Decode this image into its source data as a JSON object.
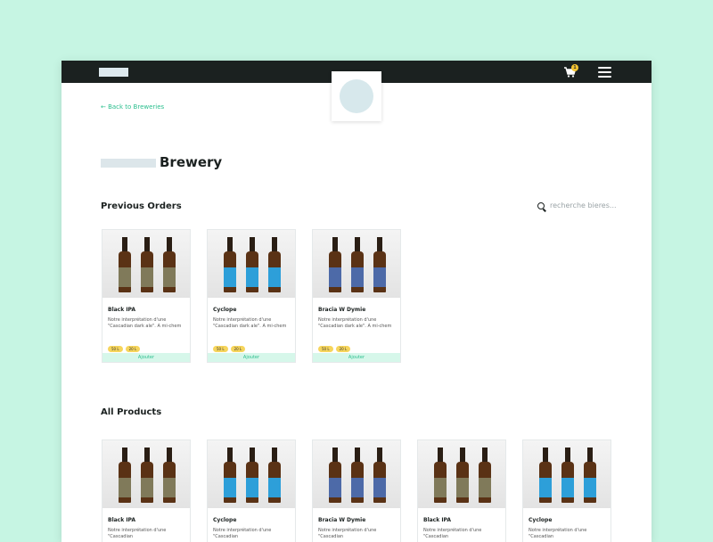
{
  "nav": {
    "cart_count": "1"
  },
  "back_link": "← Back to Breweries",
  "page_title": "Brewery",
  "previous_orders": {
    "title": "Previous Orders",
    "search_placeholder": "recherche bieres...",
    "items": [
      {
        "name": "Black IPA",
        "desc": "Notre interprétation d'une \"Cascadian dark ale\". A mi-chem",
        "tag1": "50 L",
        "tag2": "20 L",
        "add": "Ajouter",
        "label_color": "#807a5a"
      },
      {
        "name": "Cyclope",
        "desc": "Notre interprétation d'une \"Cascadian dark ale\". A mi-chem",
        "tag1": "50 L",
        "tag2": "20 L",
        "add": "Ajouter",
        "label_color": "#2d9fd9"
      },
      {
        "name": "Bracia W Dymie",
        "desc": "Notre interprétation d'une \"Cascadian dark ale\". A mi-chem",
        "tag1": "50 L",
        "tag2": "20 L",
        "add": "Ajouter",
        "label_color": "#4d6aa8"
      }
    ]
  },
  "all_products": {
    "title": "All Products",
    "items": [
      {
        "name": "Black IPA",
        "desc": "Notre interprétation d'une \"Cascadian",
        "label_color": "#807a5a"
      },
      {
        "name": "Cyclope",
        "desc": "Notre interprétation d'une \"Cascadian",
        "label_color": "#2d9fd9"
      },
      {
        "name": "Bracia W Dymie",
        "desc": "Notre interprétation d'une \"Cascadian",
        "label_color": "#4d6aa8"
      },
      {
        "name": "Black IPA",
        "desc": "Notre interprétation d'une \"Cascadian",
        "label_color": "#807a5a"
      },
      {
        "name": "Cyclope",
        "desc": "Notre interprétation d'une \"Cascadian",
        "label_color": "#2d9fd9"
      }
    ]
  }
}
